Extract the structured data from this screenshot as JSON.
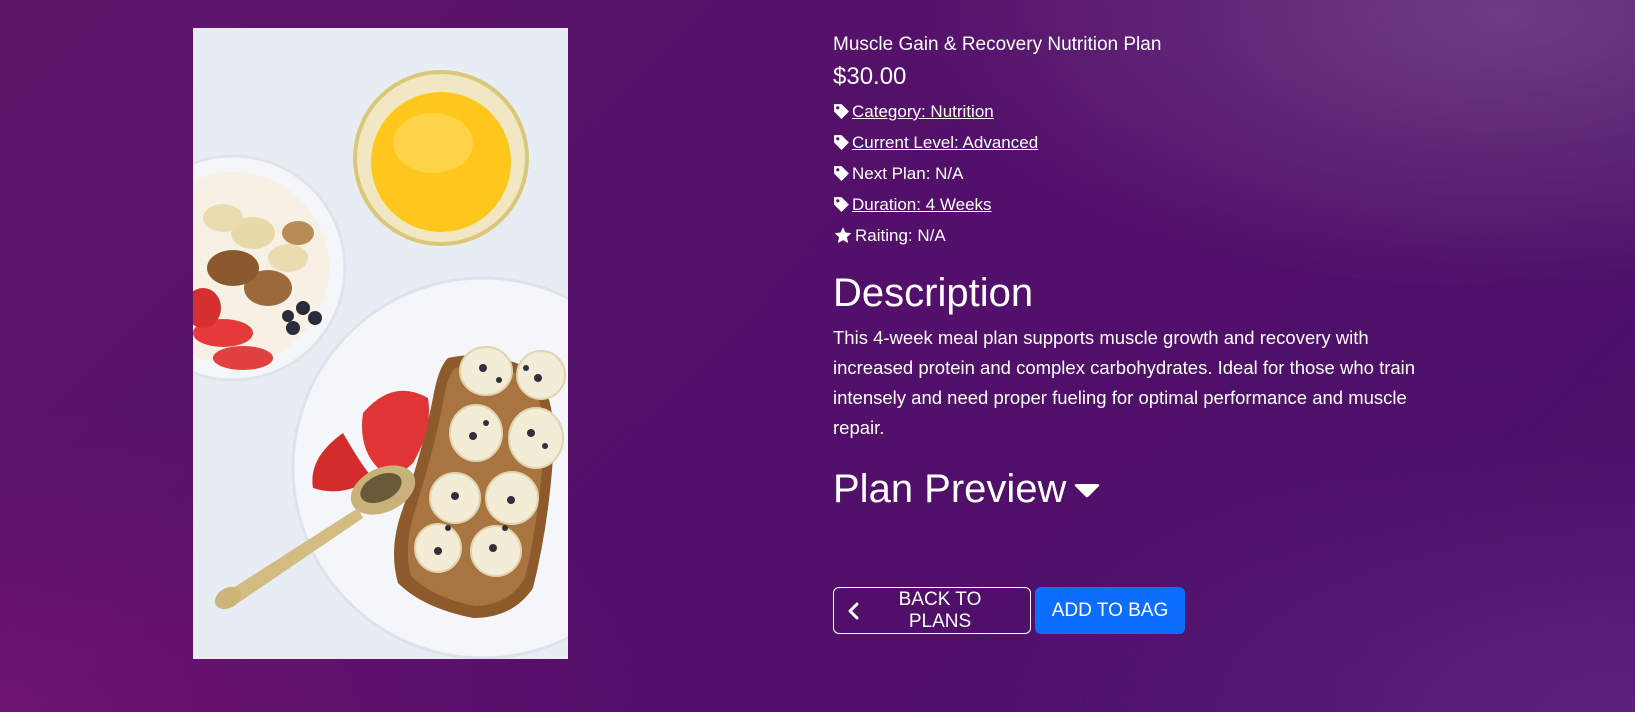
{
  "product": {
    "title": "Muscle Gain & Recovery Nutrition Plan",
    "price": "$30.00",
    "image_icon": "food-photo",
    "meta": {
      "category": "Category: Nutrition",
      "current_level": "Current Level: Advanced",
      "next_plan": "Next Plan: N/A",
      "duration": "Duration: 4 Weeks",
      "rating": "Raiting: N/A"
    }
  },
  "description": {
    "heading": "Description",
    "text": "This 4-week meal plan supports muscle growth and recovery with increased protein and complex carbohydrates. Ideal for those who train intensely and need proper fueling for optimal performance and muscle repair."
  },
  "plan_preview": {
    "heading": "Plan Preview",
    "toggle_icon": "caret-down-icon"
  },
  "actions": {
    "back_label": "BACK TO PLANS",
    "add_label": "ADD TO BAG"
  },
  "colors": {
    "background": "#52106a",
    "primary_button": "#0d6efd",
    "text": "#ffffff"
  }
}
